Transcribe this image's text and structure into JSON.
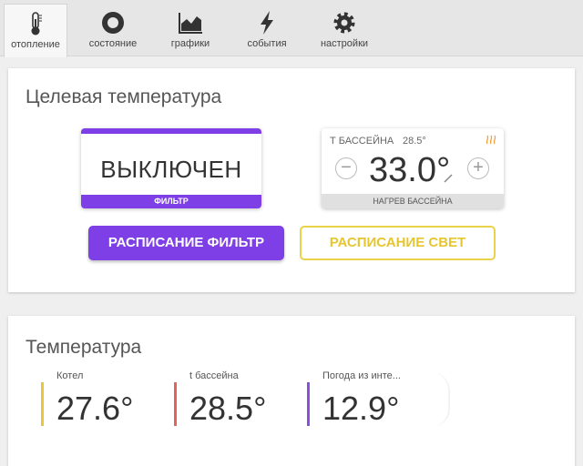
{
  "nav": {
    "tabs": [
      {
        "label": "отопление",
        "icon": "thermometer-icon",
        "active": true
      },
      {
        "label": "состояние",
        "icon": "circle-status-icon",
        "active": false
      },
      {
        "label": "графики",
        "icon": "chart-icon",
        "active": false
      },
      {
        "label": "события",
        "icon": "lightning-icon",
        "active": false
      },
      {
        "label": "настройки",
        "icon": "gear-icon",
        "active": false
      }
    ]
  },
  "target_card": {
    "title": "Целевая температура",
    "filter_widget": {
      "state": "ВЫКЛЮЧЕН",
      "label": "ФИЛЬТР"
    },
    "thermostat": {
      "name": "Т БАССЕЙНА",
      "current": "28.5°",
      "target": "33.0°",
      "minus": "−",
      "plus": "+",
      "label": "НАГРЕВ БАССЕЙНА"
    },
    "buttons": {
      "filter_schedule": "РАСПИСАНИЕ ФИЛЬТР",
      "light_schedule": "РАСПИСАНИЕ СВЕТ"
    }
  },
  "temp_card": {
    "title": "Температура",
    "readouts": [
      {
        "label": "Котел",
        "value": "27.6°",
        "color": "#e8c53a"
      },
      {
        "label": "t бассейна",
        "value": "28.5°",
        "color": "#e5635f"
      },
      {
        "label": "Погода из инте...",
        "value": "12.9°",
        "color": "#8b4fe0"
      }
    ]
  },
  "colors": {
    "accent_purple": "#7f3fe6",
    "accent_yellow": "#e6c630",
    "heat_orange": "#f0a040"
  }
}
